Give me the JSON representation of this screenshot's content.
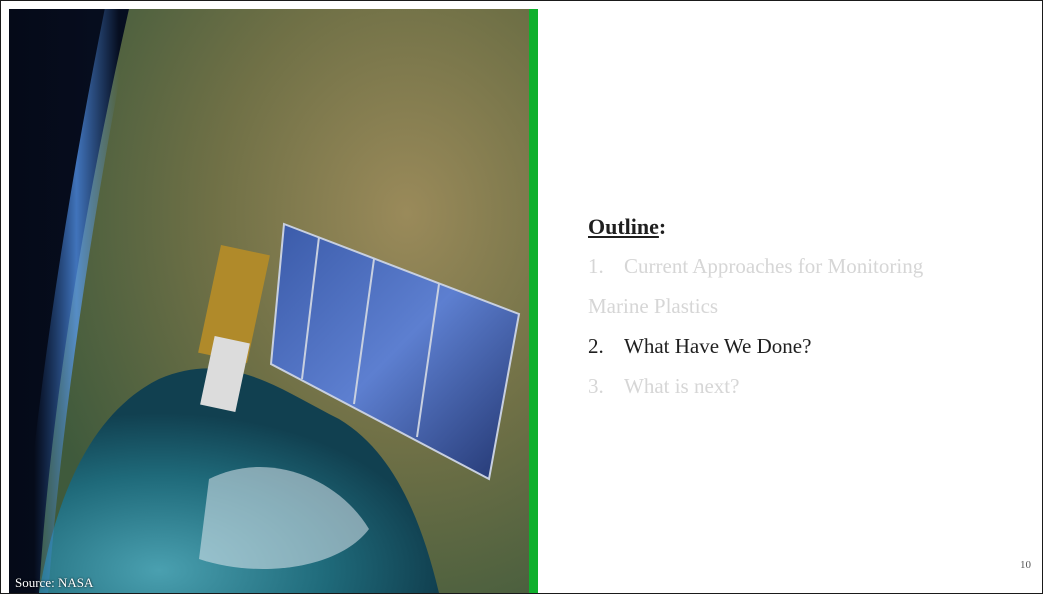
{
  "slide": {
    "photo_caption": "Source: NASA",
    "outline_title": "Outline",
    "outline_colon": ":",
    "items": [
      {
        "number": "1.",
        "line1": "Current Approaches for Monitoring",
        "line2": "Marine Plastics",
        "state": "dimmed"
      },
      {
        "number": "2.",
        "text": "What Have We Done?",
        "state": "active"
      },
      {
        "number": "3.",
        "text": "What is next?",
        "state": "dimmed"
      }
    ],
    "page_number": "10"
  },
  "colors": {
    "divider": "#0fb02c",
    "active_text": "#1f1f1f",
    "dimmed_text": "#d6d6d6"
  }
}
